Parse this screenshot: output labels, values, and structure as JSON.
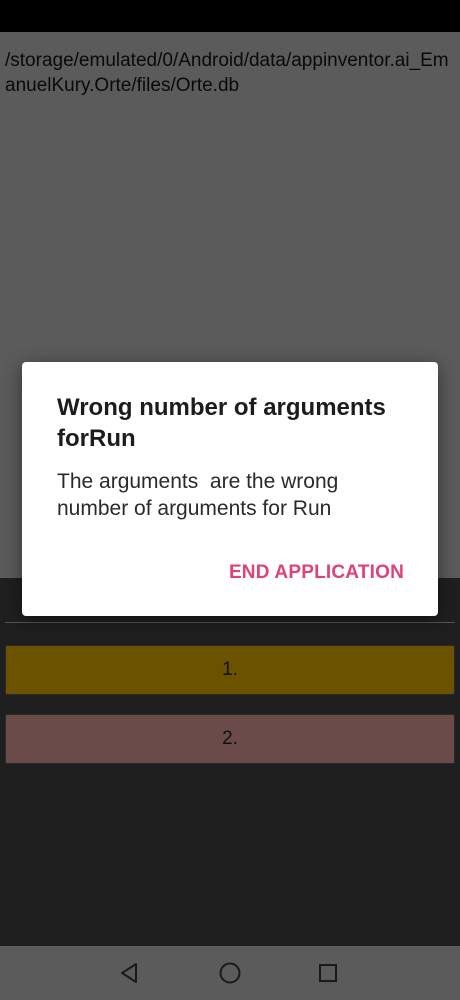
{
  "app": {
    "db_path": "/storage/emulated/0/Android/data/appinventor.ai_EmanuelKury.Orte/files/Orte.db"
  },
  "buttons": [
    {
      "label": "1.",
      "color": "#6a5200"
    },
    {
      "label": "2.",
      "color": "#6b4a4a"
    }
  ],
  "dialog": {
    "title": "Wrong number of arguments forRun",
    "message": "The arguments  are the wrong number of arguments for Run",
    "action_label": "END APPLICATION",
    "action_color": "#e0417a"
  },
  "nav": {
    "back_icon": "back-triangle-icon",
    "home_icon": "home-circle-icon",
    "recents_icon": "recents-square-icon"
  }
}
